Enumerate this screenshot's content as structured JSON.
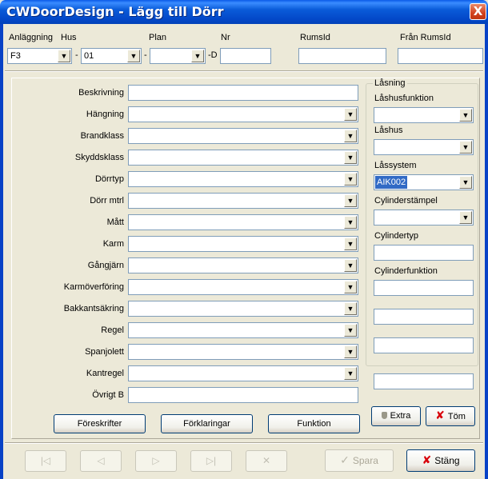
{
  "window": {
    "title": "CWDoorDesign - Lägg till Dörr",
    "close_glyph": "X"
  },
  "header": {
    "anlaggning": {
      "label": "Anläggning",
      "value": "F3"
    },
    "hus": {
      "label": "Hus",
      "value": "01"
    },
    "plan": {
      "label": "Plan",
      "value": ""
    },
    "nr": {
      "label": "Nr",
      "value": ""
    },
    "rumsid": {
      "label": "RumsId",
      "value": ""
    },
    "fran_rumsid": {
      "label": "Från RumsId",
      "value": ""
    },
    "sep1": "-",
    "sep2": "-",
    "sep3": "-D"
  },
  "form": {
    "fields": [
      {
        "label": "Beskrivning",
        "type": "text",
        "value": ""
      },
      {
        "label": "Hängning",
        "type": "combo",
        "value": ""
      },
      {
        "label": "Brandklass",
        "type": "combo",
        "value": ""
      },
      {
        "label": "Skyddsklass",
        "type": "combo",
        "value": ""
      },
      {
        "label": "Dörrtyp",
        "type": "combo",
        "value": ""
      },
      {
        "label": "Dörr mtrl",
        "type": "combo",
        "value": ""
      },
      {
        "label": "Mått",
        "type": "combo",
        "value": ""
      },
      {
        "label": "Karm",
        "type": "combo",
        "value": ""
      },
      {
        "label": "Gångjärn",
        "type": "combo",
        "value": ""
      },
      {
        "label": "Karmöverföring",
        "type": "combo",
        "value": ""
      },
      {
        "label": "Bakkantsäkring",
        "type": "combo",
        "value": ""
      },
      {
        "label": "Regel",
        "type": "combo",
        "value": ""
      },
      {
        "label": "Spanjolett",
        "type": "combo",
        "value": ""
      },
      {
        "label": "Kantregel",
        "type": "combo",
        "value": ""
      },
      {
        "label": "Övrigt B",
        "type": "text",
        "value": ""
      }
    ],
    "buttons": {
      "foreskrifter": "Föreskrifter",
      "forklaringar": "Förklaringar",
      "funktion": "Funktion"
    }
  },
  "lasning": {
    "title": "Låsning",
    "lashusfunktion": {
      "label": "Låshusfunktion",
      "value": ""
    },
    "lashus": {
      "label": "Låshus",
      "value": ""
    },
    "lassystem": {
      "label": "Låssystem",
      "value": "AIK002"
    },
    "cylinderstampel": {
      "label": "Cylinderstämpel",
      "value": ""
    },
    "cylindertyp": {
      "label": "Cylindertyp",
      "value": ""
    },
    "cylinderfunktion": {
      "label": "Cylinderfunktion",
      "values": [
        "",
        "",
        "",
        ""
      ]
    },
    "extra_label": "Extra",
    "tom_label": "Töm"
  },
  "footer": {
    "nav": [
      "|◁",
      "◁",
      "▷",
      "▷|",
      "✕"
    ],
    "spara_label": "Spara",
    "stang_label": "Stäng"
  },
  "glyphs": {
    "dropdown": "▼",
    "close": "✘",
    "check": "✓"
  }
}
